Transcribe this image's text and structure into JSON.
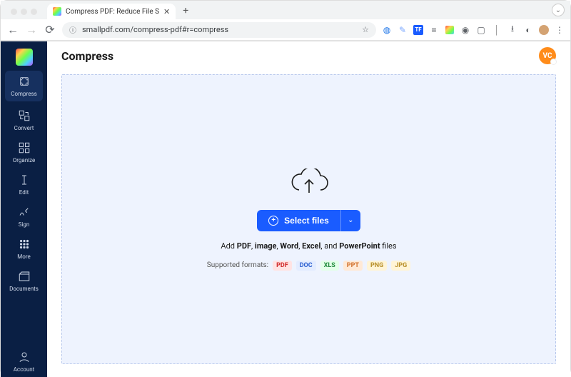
{
  "browser": {
    "tab_title": "Compress PDF: Reduce File S",
    "url": "smallpdf.com/compress-pdf#r=compress"
  },
  "header": {
    "title": "Compress",
    "avatar_initials": "VC"
  },
  "sidebar": {
    "items": [
      {
        "label": "Compress"
      },
      {
        "label": "Convert"
      },
      {
        "label": "Organize"
      },
      {
        "label": "Edit"
      },
      {
        "label": "Sign"
      },
      {
        "label": "More"
      },
      {
        "label": "Documents"
      }
    ],
    "account_label": "Account"
  },
  "dropzone": {
    "button_label": "Select files",
    "hint_prefix": "Add ",
    "hint_b1": "PDF",
    "hint_sep1": ", ",
    "hint_b2": "image",
    "hint_sep2": ", ",
    "hint_b3": "Word",
    "hint_sep3": ", ",
    "hint_b4": "Excel",
    "hint_sep4": ", and ",
    "hint_b5": "PowerPoint",
    "hint_suffix": " files",
    "supported_label": "Supported formats:",
    "formats": {
      "pdf": "PDF",
      "doc": "DOC",
      "xls": "XLS",
      "ppt": "PPT",
      "png": "PNG",
      "jpg": "JPG"
    }
  }
}
